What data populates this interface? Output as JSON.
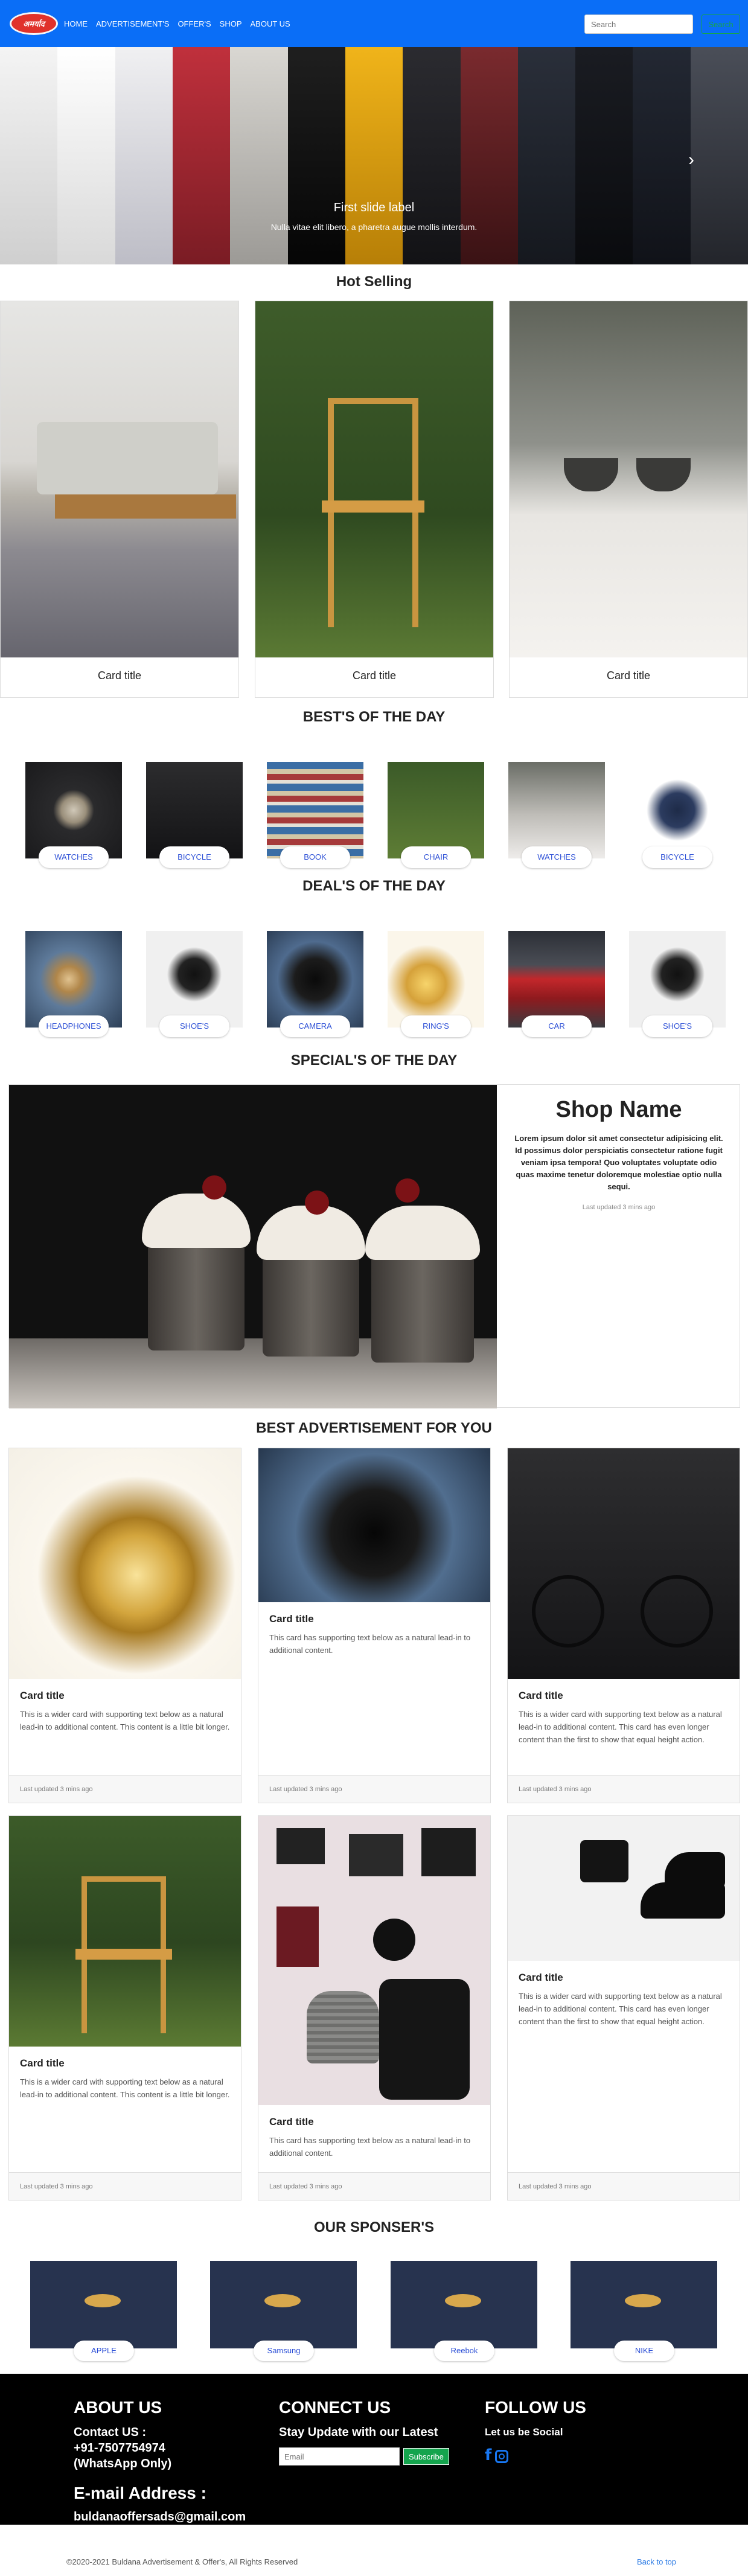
{
  "colors": {
    "navbar": "#0a6ef7",
    "accent_green": "#14a44d",
    "footer_bg": "#000000",
    "pill_text": "#2c4fd6"
  },
  "navbar": {
    "logo_text": "अमर्याद",
    "links": [
      "HOME",
      "ADVERTISEMENT'S",
      "OFFER'S",
      "SHOP",
      "ABOUT US"
    ],
    "search_placeholder": "Search",
    "search_button": "Search"
  },
  "carousel": {
    "caption_title": "First slide label",
    "caption_text": "Nulla vitae elit libero, a pharetra augue mollis interdum.",
    "next_icon": "chevron-right-icon"
  },
  "hot_selling": {
    "title": "Hot Selling",
    "cards": [
      {
        "title": "Card title",
        "image": "living room sofa"
      },
      {
        "title": "Card title",
        "image": "wooden chair"
      },
      {
        "title": "Card title",
        "image": "sunglasses"
      }
    ]
  },
  "bests": {
    "title": "BEST'S OF THE DAY",
    "items": [
      {
        "label": "WATCHES"
      },
      {
        "label": "BICYCLE"
      },
      {
        "label": "BOOK"
      },
      {
        "label": "CHAIR"
      },
      {
        "label": "WATCHES"
      },
      {
        "label": "BICYCLE"
      }
    ]
  },
  "deals": {
    "title": "DEAL'S OF THE DAY",
    "items": [
      {
        "label": "HEADPHONES"
      },
      {
        "label": "SHOE'S"
      },
      {
        "label": "CAMERA"
      },
      {
        "label": "RING'S"
      },
      {
        "label": "CAR"
      },
      {
        "label": "SHOE'S"
      }
    ]
  },
  "special": {
    "title": "SPECIAL'S OF THE DAY",
    "shop_name": "Shop Name",
    "text": "Lorem ipsum dolor sit amet consectetur adipisicing elit. Id possimus dolor perspiciatis consectetur ratione fugit veniam ipsa tempora! Quo voluptates voluptate odio quas maxime tenetur doloremque molestiae optio nulla sequi.",
    "updated": "Last updated 3 mins ago"
  },
  "ads": {
    "title": "BEST ADVERTISEMENT FOR YOU",
    "cards": [
      {
        "title": "Card title",
        "text": "This is a wider card with supporting text below as a natural lead-in to additional content. This content is a little bit longer.",
        "footer": "Last updated 3 mins ago"
      },
      {
        "title": "Card title",
        "text": "This card has supporting text below as a natural lead-in to additional content.",
        "footer": "Last updated 3 mins ago"
      },
      {
        "title": "Card title",
        "text": "This is a wider card with supporting text below as a natural lead-in to additional content. This card has even longer content than the first to show that equal height action.",
        "footer": "Last updated 3 mins ago"
      },
      {
        "title": "Card title",
        "text": "This is a wider card with supporting text below as a natural lead-in to additional content. This content is a little bit longer.",
        "footer": "Last updated 3 mins ago"
      },
      {
        "title": "Card title",
        "text": "This card has supporting text below as a natural lead-in to additional content.",
        "footer": "Last updated 3 mins ago"
      },
      {
        "title": "Card title",
        "text": "This is a wider card with supporting text below as a natural lead-in to additional content. This card has even longer content than the first to show that equal height action.",
        "footer": "Last updated 3 mins ago"
      }
    ]
  },
  "sponsers": {
    "title": "OUR SPONSER'S",
    "items": [
      {
        "label": "APPLE"
      },
      {
        "label": "Samsung"
      },
      {
        "label": "Reebok"
      },
      {
        "label": "NIKE"
      }
    ]
  },
  "footer": {
    "about_title": "ABOUT US",
    "contact_label": "Contact US :",
    "phone": "+91-7507754974",
    "whatsapp": "(WhatsApp Only)",
    "email_label": "E-mail Address :",
    "email": "buldanaoffersads@gmail.com",
    "connect_title": "CONNECT US",
    "connect_sub": "Stay Update with our Latest",
    "email_placeholder": "Email",
    "subscribe_label": "Subscribe",
    "follow_title": "FOLLOW US",
    "follow_sub": "Let us be Social",
    "social_icons": [
      "facebook-icon",
      "instagram-icon"
    ]
  },
  "bottom": {
    "copyright": "©2020-2021 Buldana Advertisement & Offer's, All Rights Reserved",
    "back_to_top": "Back to top"
  }
}
